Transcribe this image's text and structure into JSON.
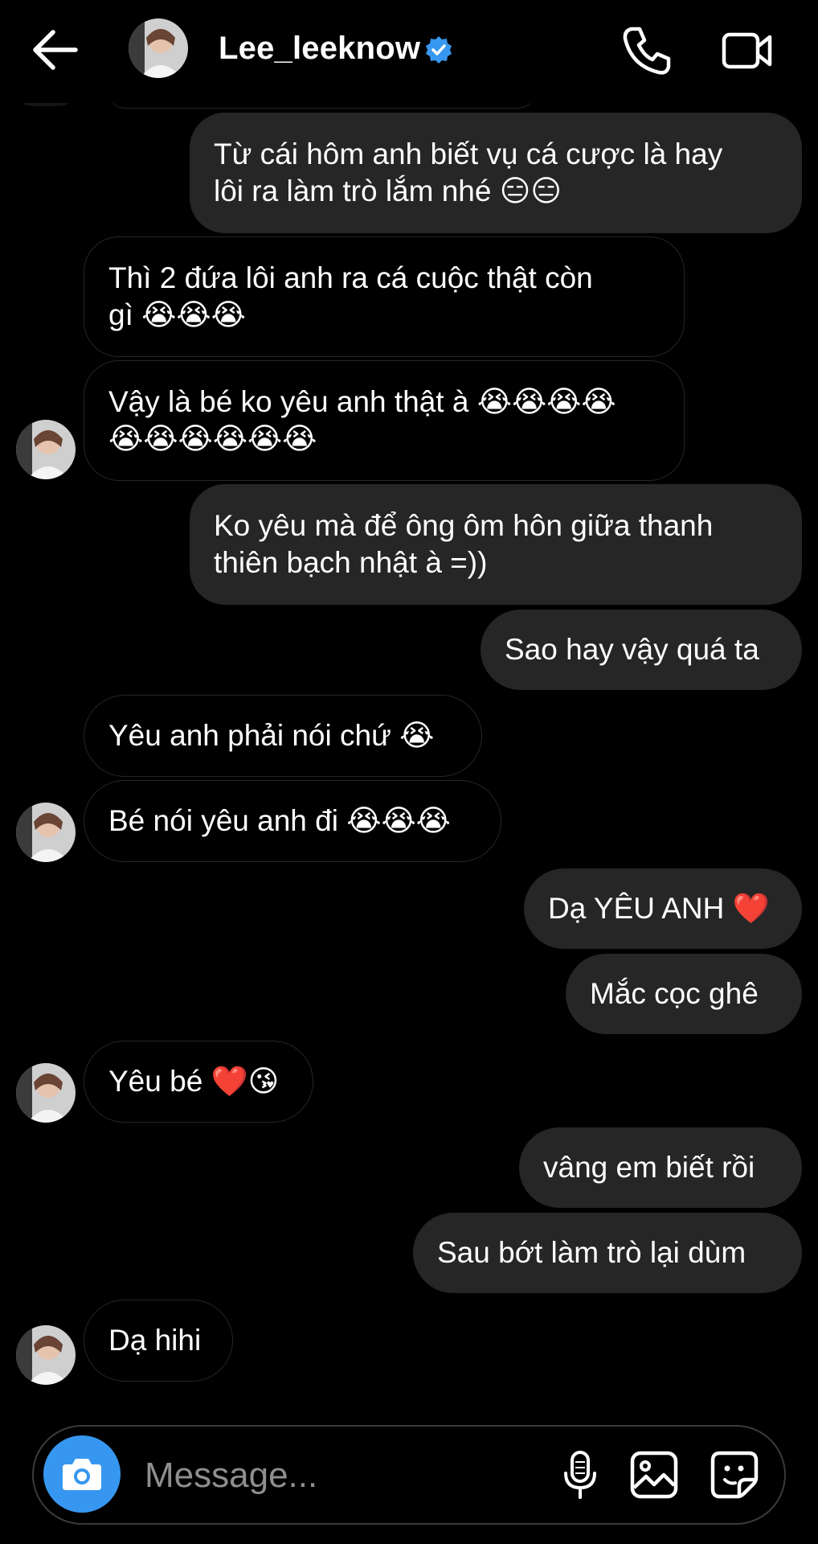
{
  "header": {
    "username": "Lee_leeknow",
    "verified": true,
    "icons": [
      "back-arrow-icon",
      "verified-badge-icon",
      "phone-icon",
      "video-camera-icon"
    ]
  },
  "messages": [
    {
      "side": "out",
      "text": "Từ cái hôm anh biết vụ cá cược là hay\nlôi ra làm trò lắm nhé 😑😑"
    },
    {
      "side": "in",
      "text": "Thì 2 đứa lôi anh ra cá cuộc thật còn\ngì 😭😭😭"
    },
    {
      "side": "in",
      "text": "Vậy là bé ko yêu anh thật à 😭😭😭😭\n😭😭😭😭😭😭"
    },
    {
      "side": "out",
      "text": "Ko yêu mà để ông ôm hôn giữa thanh\nthiên bạch nhật à =))"
    },
    {
      "side": "out",
      "text": "Sao hay vậy quá ta"
    },
    {
      "side": "in",
      "text": "Yêu anh phải nói chứ 😭"
    },
    {
      "side": "in",
      "text": "Bé nói yêu anh đi 😭😭😭"
    },
    {
      "side": "out",
      "text": "Dạ YÊU ANH ❤️"
    },
    {
      "side": "out",
      "text": "Mắc cọc ghê"
    },
    {
      "side": "in",
      "text": "Yêu bé ❤️😘"
    },
    {
      "side": "out",
      "text": "vâng em biết rồi"
    },
    {
      "side": "out",
      "text": "Sau bớt làm trò lại dùm"
    },
    {
      "side": "in",
      "text": "Dạ hihi"
    }
  ],
  "composer": {
    "placeholder": "Message...",
    "icons": [
      "camera-icon",
      "microphone-icon",
      "gallery-icon",
      "sticker-icon"
    ],
    "camera_color": "#3797f0"
  },
  "colors": {
    "background": "#000000",
    "bubble": "#262626",
    "verified": "#3897f0"
  }
}
